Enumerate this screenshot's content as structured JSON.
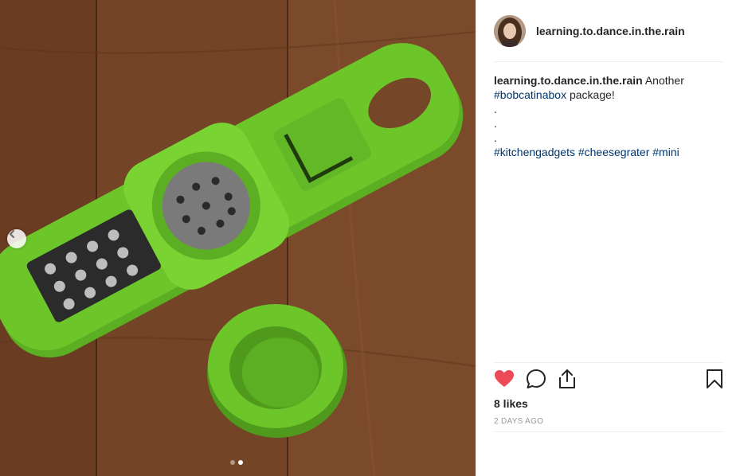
{
  "post": {
    "username": "learning.to.dance.in.the.rain",
    "caption": {
      "username": "learning.to.dance.in.the.rain",
      "text_before": "Another",
      "tag_1": "#bobcatinabox",
      "text_after": "package!",
      "dot_1": ".",
      "dot_2": ".",
      "dot_3": ".",
      "tag_2": "#kitchengadgets",
      "tag_3": "#cheesegrater",
      "tag_4": "#mini"
    },
    "likes": "8 likes",
    "timestamp": "2 DAYS AGO"
  },
  "carousel": {
    "total": 2,
    "current": 2
  },
  "icons": {
    "like": "heart-icon",
    "comment": "comment-icon",
    "share": "share-icon",
    "save": "bookmark-icon",
    "prev": "chevron-left-icon"
  },
  "colors": {
    "heart": "#ed4956",
    "hashtag": "#003569",
    "grater_green": "#6cc62a",
    "wood": "#7a4a2b"
  }
}
